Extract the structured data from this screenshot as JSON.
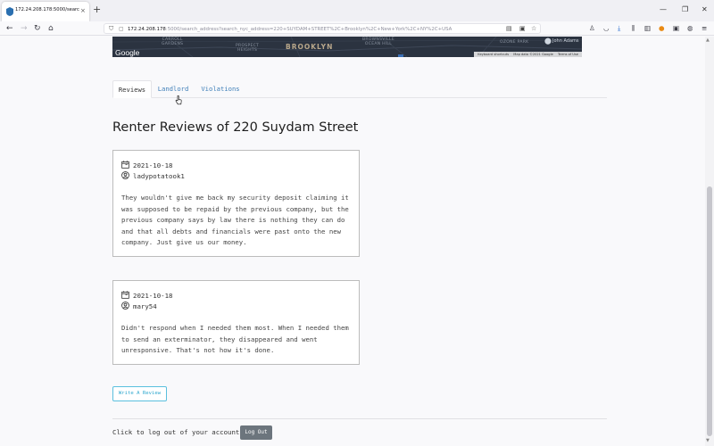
{
  "browser": {
    "tab_title": "172.24.208.178:5000/search_ad...",
    "url_host": "172.24.208.178",
    "url_rest": ":5000/search_address?search_nyc_address=220+SUYDAM+STREET%2C+Brooklyn%2C+New+York%2C+NY%2C+USA",
    "new_tab": "+",
    "close_tab": "×",
    "back": "←",
    "forward": "→",
    "reload": "↻",
    "home": "⌂",
    "minimize": "—",
    "restore": "❐",
    "close_window": "✕"
  },
  "map": {
    "neighborhoods": [
      "CARROLL\nGARDENS",
      "PROSPECT\nHEIGHTS",
      "BROWNSVILLE\nOCEAN HILL",
      "OZONE PARK"
    ],
    "borough": "BROOKLYN",
    "place": "John Adams",
    "logo": "Google",
    "footer": [
      "Keyboard shortcuts",
      "Map data ©2021 Google",
      "Terms of Use"
    ]
  },
  "tabs": [
    "Reviews",
    "Landlord",
    "Violations"
  ],
  "heading": "Renter Reviews of 220 Suydam Street",
  "reviews": [
    {
      "date": "2021-10-18",
      "user": "ladypotatook1",
      "text": "They wouldn't give me back my security deposit claiming it was supposed to be repaid by the previous company, but the previous company says by law there is nothing they can do and that all debts and financials were past onto the new company. Just give us our money."
    },
    {
      "date": "2021-10-18",
      "user": "mary54",
      "text": "Didn't respond when I needed them most. When I needed them to send an exterminator, they disappeared and went unresponsive. That's not how it's done."
    }
  ],
  "write_review_label": "Write A Review",
  "logout_prompt": "Click to log out of your account:",
  "logout_label": "Log Out",
  "colors": {
    "link": "#3f7fb8",
    "outline_button": "#5bc0de",
    "logout_button": "#6c757d"
  }
}
